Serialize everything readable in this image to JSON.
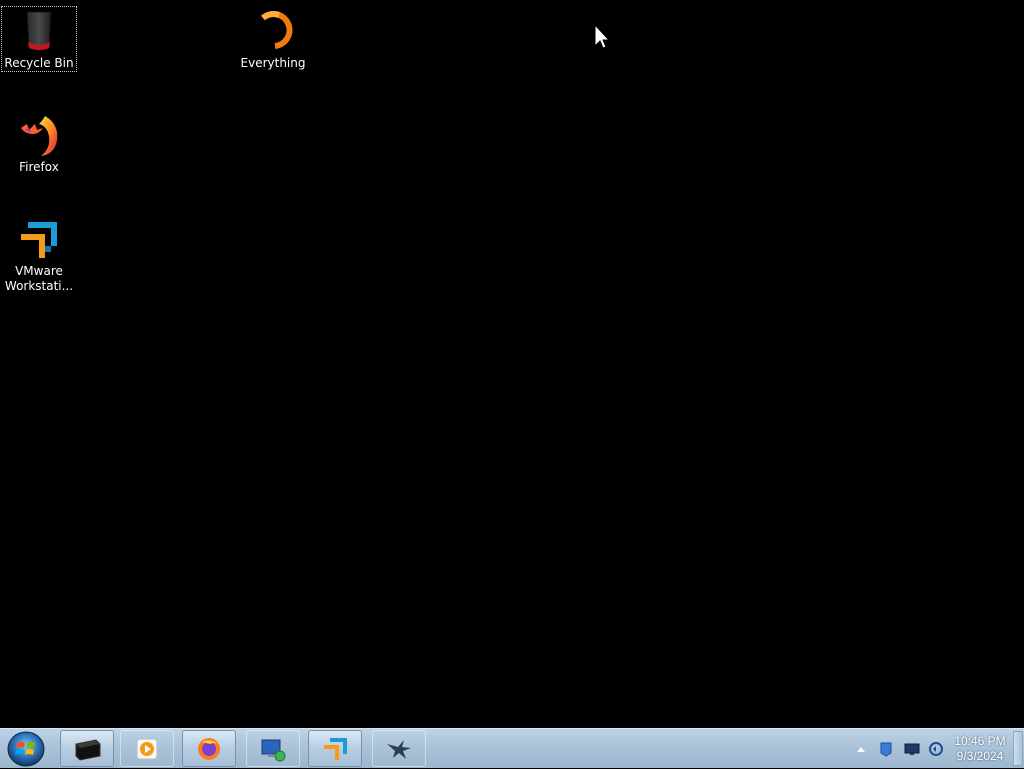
{
  "desktop": {
    "icons": [
      {
        "label": "Recycle Bin",
        "icon": "recycle-bin-icon"
      },
      {
        "label": "Everything",
        "icon": "everything-search-icon"
      },
      {
        "label": "Firefox",
        "icon": "firefox-icon"
      },
      {
        "label": "VMware Workstati...",
        "icon": "vmware-workstation-icon"
      }
    ]
  },
  "taskbar": {
    "start": {
      "icon": "windows-start-icon"
    },
    "pinned": [
      {
        "icon": "command-prompt-icon"
      },
      {
        "icon": "media-player-icon"
      },
      {
        "icon": "firefox-icon"
      },
      {
        "icon": "remote-desktop-icon"
      },
      {
        "icon": "vmware-workstation-icon"
      },
      {
        "icon": "eagle-app-icon"
      }
    ],
    "tray": {
      "icons": [
        "show-hidden-icons-arrow",
        "network-shield-icon",
        "display-icon",
        "volume-network-icon"
      ],
      "time": "10:46 PM",
      "date": "9/3/2024"
    }
  },
  "colors": {
    "desktop_background": "#000000",
    "taskbar": "#a9c2d8"
  }
}
